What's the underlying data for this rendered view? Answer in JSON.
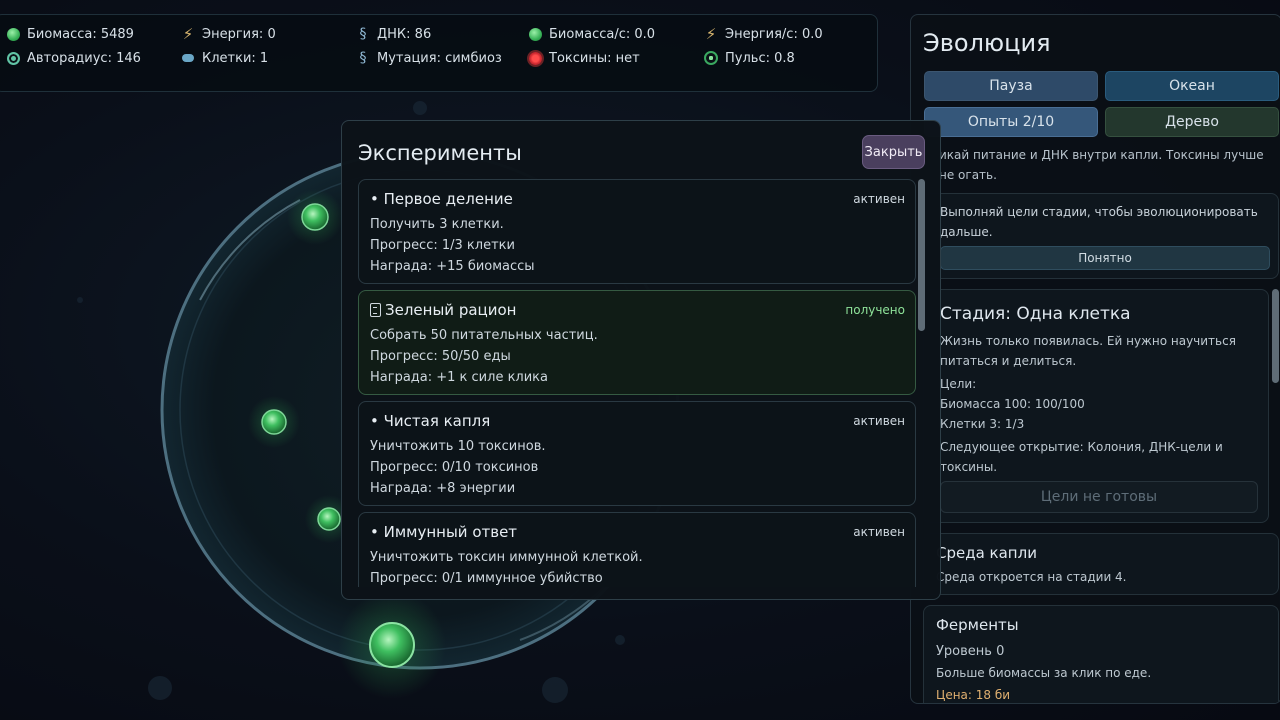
{
  "stats": {
    "biomass": "Биомасса: 5489",
    "energy": "Энергия: 0",
    "dna": "ДНК: 86",
    "biomass_rate": "Биомасса/с: 0.0",
    "energy_rate": "Энергия/с: 0.0",
    "autoradius": "Авторадиус: 146",
    "cells": "Клетки: 1",
    "mutation": "Мутация: симбиоз",
    "toxins": "Токсины: нет",
    "pulse": "Пульс: 0.8"
  },
  "evolution": {
    "title": "Эволюция",
    "buttons": {
      "pause": "Пауза",
      "ocean": "Океан",
      "experiments": "Опыты 2/10",
      "tree": "Дерево"
    },
    "hint": "икай питание и ДНК внутри капли. Токсины лучше не огать.",
    "tip": {
      "text": "Выполняй цели стадии, чтобы эволюционировать дальше.",
      "button": "Понятно"
    },
    "stage": {
      "title": "Стадия: Одна клетка",
      "description_1": "Жизнь только появилась. Ей нужно научиться",
      "description_2": "питаться и делиться.",
      "goals_label": "Цели:",
      "goal_1": "Биомасса 100: 100/100",
      "goal_2": "Клетки 3: 1/3",
      "next_1": "Следующее открытие: Колония, ДНК-цели и",
      "next_2": "токсины.",
      "button": "Цели не готовы"
    },
    "environment": {
      "title": "Среда капли",
      "text": "Среда откроется на стадии 4."
    },
    "enzymes": {
      "title": "Ферменты",
      "level": "Уровень 0",
      "text": "Больше биомассы за клик по еде.",
      "price": "Цена: 18 би"
    }
  },
  "experiments": {
    "title": "Эксперименты",
    "close": "Закрыть",
    "items": [
      {
        "title": "• Первое деление",
        "status": "активен",
        "goal": "Получить 3 клетки.",
        "progress": "Прогресс: 1/3 клетки",
        "reward": "Награда: +15 биомассы"
      },
      {
        "title": "Зеленый рацион",
        "status": "получено",
        "goal": "Собрать 50 питательных частиц.",
        "progress": "Прогресс: 50/50 еды",
        "reward": "Награда: +1 к силе клика"
      },
      {
        "title": "• Чистая капля",
        "status": "активен",
        "goal": "Уничтожить 10 токсинов.",
        "progress": "Прогресс: 0/10 токсинов",
        "reward": "Награда: +8 энергии"
      },
      {
        "title": "• Иммунный ответ",
        "status": "активен",
        "goal": "Уничтожить токсин иммунной клеткой.",
        "progress": "Прогресс: 0/1 иммунное убийство",
        "reward": ""
      }
    ]
  },
  "colors": {
    "accent_green": "#37b157",
    "toxin_red": "#d9323a",
    "close_button": "#4a3f5e"
  }
}
